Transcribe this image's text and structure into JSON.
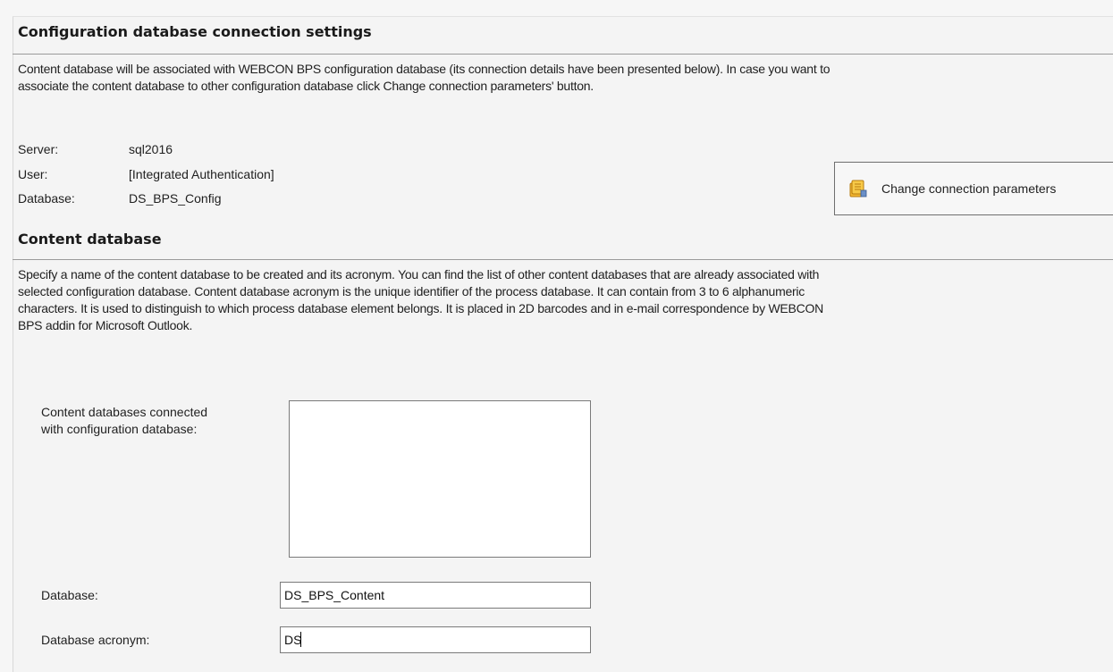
{
  "config_section": {
    "title": "Configuration database connection settings",
    "description_line1": "Content database will be associated with WEBCON BPS configuration database (its connection details have been presented below). In case you want to",
    "description_line2": "associate the content database to other configuration database click Change connection parameters' button.",
    "fields": [
      {
        "label": "Server:",
        "value": "sql2016"
      },
      {
        "label": "User:",
        "value": "[Integrated Authentication]"
      },
      {
        "label": "Database:",
        "value": "DS_BPS_Config"
      }
    ],
    "change_button": {
      "label": "Change connection parameters",
      "icon": "database-settings-icon"
    }
  },
  "content_section": {
    "title": "Content database",
    "description_lines": [
      "Specify a name of the content database to be created and its acronym. You can find the list of other content databases that are already associated with",
      "selected configuration database. Content database acronym is the unique identifier of the process database. It can contain from 3 to 6 alphanumeric",
      "characters. It is used to distinguish to which process database element belongs. It is placed in 2D barcodes and in e-mail correspondence by WEBCON",
      "BPS addin for Microsoft Outlook."
    ],
    "connected_label_line1": "Content databases connected",
    "connected_label_line2": "with configuration database:",
    "connected_databases": [],
    "database_label": "Database:",
    "database_value": "DS_BPS_Content",
    "acronym_label": "Database acronym:",
    "acronym_value": "DS"
  },
  "colors": {
    "icon_gold": "#e8a317",
    "border": "#7a7a7a"
  }
}
